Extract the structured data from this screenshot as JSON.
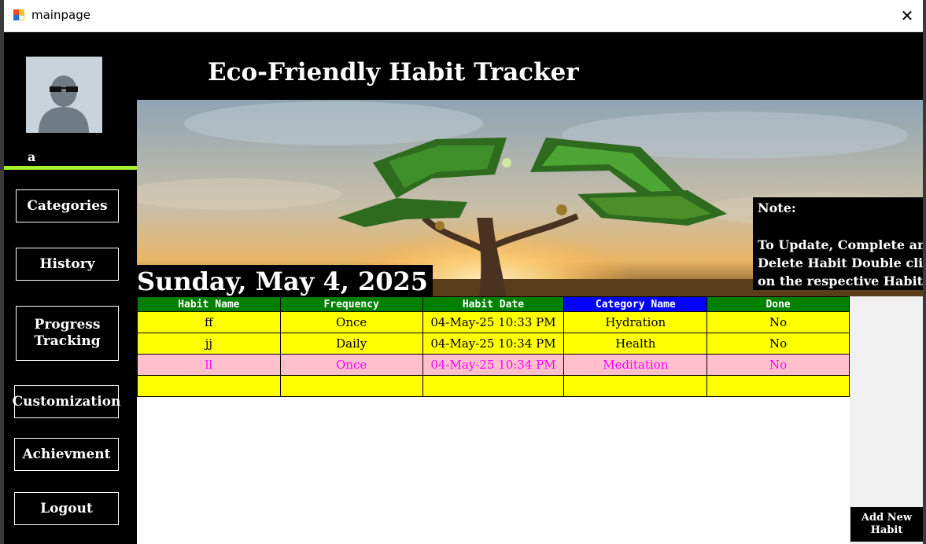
{
  "window": {
    "title": "mainpage",
    "close_glyph": "✕"
  },
  "user": {
    "name": "a"
  },
  "sidebar": {
    "items": [
      {
        "label": "Categories"
      },
      {
        "label": "History"
      },
      {
        "label": "Progress\nTracking"
      },
      {
        "label": "Customization"
      },
      {
        "label": "Achievment"
      },
      {
        "label": "Logout"
      }
    ]
  },
  "header": {
    "title": "Eco-Friendly Habit Tracker"
  },
  "main": {
    "date": "Sunday, May 4, 2025",
    "note": {
      "title": "Note:",
      "line1": "To Update, Complete and",
      "line2": "Delete Habit Double click",
      "line3": "on the respective Habit"
    },
    "table": {
      "columns": [
        "Habit Name",
        "Frequency",
        "Habit Date",
        "Category Name",
        "Done"
      ],
      "rows": [
        [
          "ff",
          "Once",
          "04-May-25 10:33 PM",
          "Hydration",
          "No"
        ],
        [
          "jj",
          "Daily",
          "04-May-25 10:34 PM",
          "Health",
          "No"
        ],
        [
          "ll",
          "Once",
          "04-May-25 10:34 PM",
          "Meditation",
          "No"
        ],
        [
          "",
          "",
          "",
          "",
          ""
        ]
      ]
    },
    "add_button": "Add New\nHabit"
  },
  "colors": {
    "accent_line": "#a4f22e",
    "header_green": "#008000",
    "header_selected": "#0000ff",
    "row_yellow": "#ffff00",
    "row_pink": "#ffc0cb",
    "pink_text": "#ff00ff"
  },
  "icons": {
    "app": "app-window-icon",
    "avatar": "user-sunglasses-avatar",
    "close": "close-icon"
  }
}
